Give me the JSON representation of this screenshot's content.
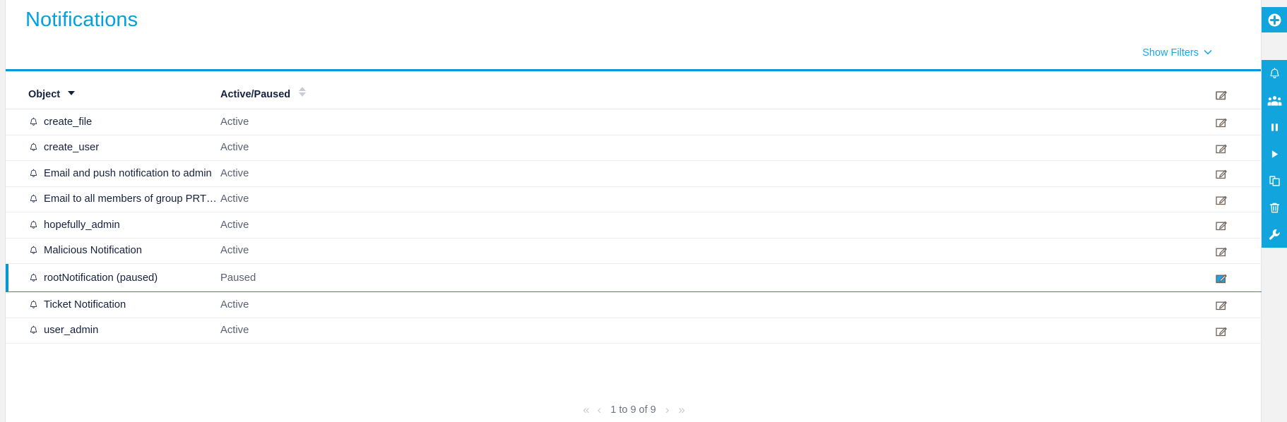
{
  "header": {
    "title": "Notifications",
    "show_filters_label": "Show Filters",
    "chevron_icon": "chevron-down-icon",
    "accent_color": "#0099d4",
    "title_color": "#00a2e0"
  },
  "table": {
    "columns": [
      {
        "key": "object",
        "label": "Object",
        "sort": "desc",
        "sort_icon": "caret-down-icon"
      },
      {
        "key": "state",
        "label": "Active/Paused",
        "sort": "none",
        "sort_icon": "caret-updown-icon"
      },
      {
        "key": "actions",
        "label": "",
        "sort": "none",
        "sort_icon": ""
      }
    ],
    "rows": [
      {
        "icon": "bell-icon",
        "object": "create_file",
        "state": "Active",
        "action_icon": "edit-icon",
        "selected": false
      },
      {
        "icon": "bell-icon",
        "object": "create_user",
        "state": "Active",
        "action_icon": "edit-icon",
        "selected": false
      },
      {
        "icon": "bell-icon",
        "object": "Email and push notification to admin",
        "state": "Active",
        "action_icon": "edit-icon",
        "selected": false
      },
      {
        "icon": "bell-icon",
        "object": "Email to all members of group PRTG Us…",
        "state": "Active",
        "action_icon": "edit-icon",
        "selected": false
      },
      {
        "icon": "bell-icon",
        "object": "hopefully_admin",
        "state": "Active",
        "action_icon": "edit-icon",
        "selected": false
      },
      {
        "icon": "bell-icon",
        "object": "Malicious Notification",
        "state": "Active",
        "action_icon": "edit-icon",
        "selected": false
      },
      {
        "icon": "bell-icon",
        "object": "rootNotification (paused)",
        "state": "Paused",
        "action_icon": "edit-icon",
        "selected": true
      },
      {
        "icon": "bell-icon",
        "object": "Ticket Notification",
        "state": "Active",
        "action_icon": "edit-icon",
        "selected": false
      },
      {
        "icon": "bell-icon",
        "object": "user_admin",
        "state": "Active",
        "action_icon": "edit-icon",
        "selected": false
      }
    ]
  },
  "pagination": {
    "first_label": "«",
    "prev_label": "‹",
    "range_text": "1 to 9 of 9",
    "next_label": "›",
    "last_label": "»"
  },
  "sidebar": {
    "background_color": "#12a5dd",
    "top_items": [
      {
        "name": "add-icon",
        "title": "Add"
      }
    ],
    "items": [
      {
        "name": "bell-icon",
        "title": "Notification"
      },
      {
        "name": "users-icon",
        "title": "User Groups"
      },
      {
        "name": "pause-icon",
        "title": "Pause"
      },
      {
        "name": "play-icon",
        "title": "Resume"
      },
      {
        "name": "copy-icon",
        "title": "Clone"
      },
      {
        "name": "trash-icon",
        "title": "Delete"
      },
      {
        "name": "wrench-icon",
        "title": "Settings"
      }
    ]
  }
}
